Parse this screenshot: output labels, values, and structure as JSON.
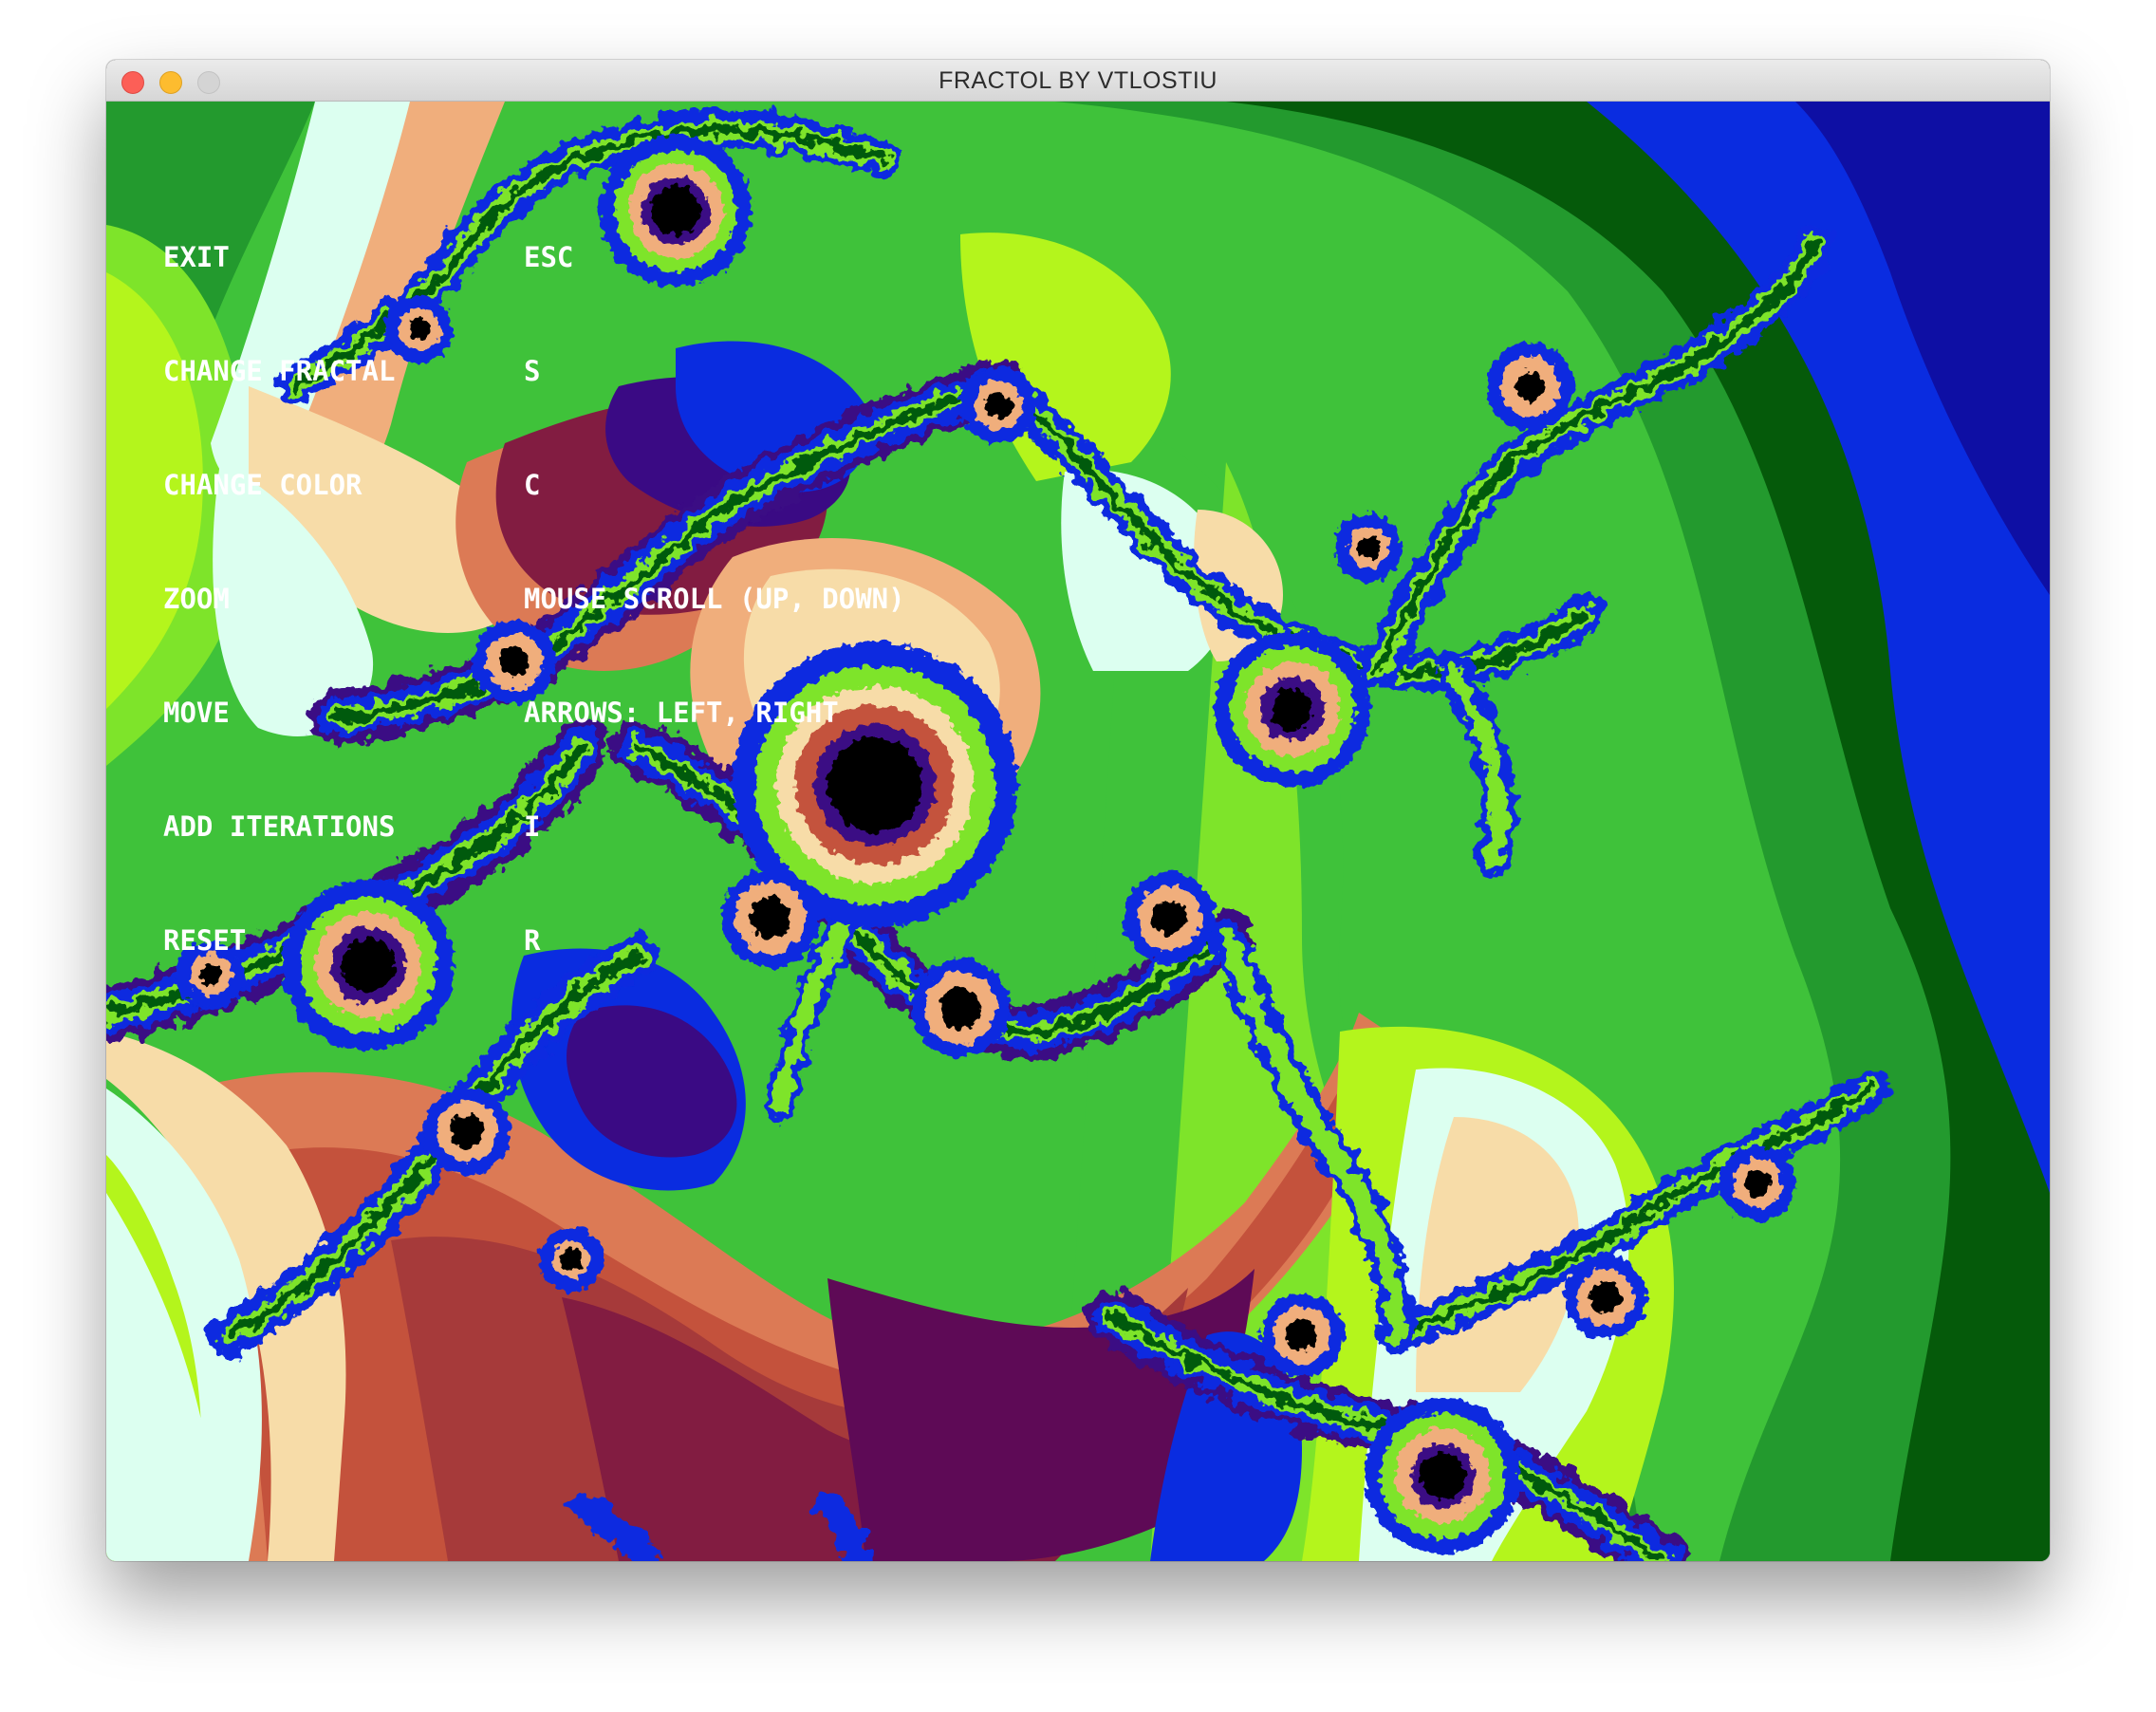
{
  "window": {
    "title": "FRACTOL BY VTLOSTIU",
    "controls": [
      "close",
      "minimize",
      "zoom"
    ]
  },
  "controls_overlay": [
    {
      "key": "EXIT",
      "value": "ESC"
    },
    {
      "key": "CHANGE FRACTAL",
      "value": "S"
    },
    {
      "key": "CHANGE COLOR",
      "value": "C"
    },
    {
      "key": "ZOOM",
      "value": "MOUSE SCROLL (UP, DOWN)"
    },
    {
      "key": "MOVE",
      "value": "ARROWS: LEFT, RIGHT"
    },
    {
      "key": "ADD ITERATIONS",
      "value": "I"
    },
    {
      "key": "RESET",
      "value": "R"
    }
  ],
  "palette": {
    "dark_green": "#055a0a",
    "green": "#239a2e",
    "mid_green": "#3fc23a",
    "lime": "#7ee42a",
    "yellow_green": "#b4f51c",
    "mint": "#dcfff0",
    "cream": "#f7dca8",
    "peach": "#f0ae7c",
    "salmon": "#dc7a55",
    "rust": "#c4523c",
    "brick": "#a63a3a",
    "maroon": "#821c41",
    "plum": "#5e0a56",
    "indigo": "#3a0a84",
    "blue": "#0a2ce0",
    "deep_blue": "#0e0fa4",
    "black": "#000000"
  }
}
